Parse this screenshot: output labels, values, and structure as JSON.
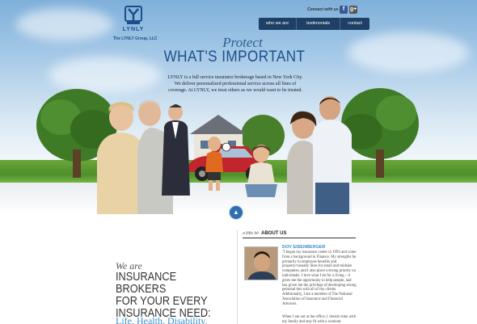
{
  "brand": {
    "logo_word": "LYNLY",
    "tagline": "The LYNLY Group, LLC"
  },
  "social": {
    "connect_label": "Connect with us on:",
    "icons": [
      "facebook-icon",
      "google-plus-icon"
    ]
  },
  "nav": {
    "items": [
      "who we are",
      "testimonials",
      "contact"
    ]
  },
  "hero": {
    "protect": "Protect",
    "headline": "WHAT'S IMPORTANT",
    "intro": "LYNLY is a full service insurance brokerage based in New York City. We deliver personalized professional service across all lines of coverage. At LYNLY, we treat others as we would want to be treated."
  },
  "insurance": {
    "we_are": "We are",
    "brokers_lines": [
      "INSURANCE BROKERS",
      "FOR YOUR EVERY",
      "INSURANCE NEED:"
    ],
    "tagline": "Life. Health. Disability."
  },
  "about": {
    "small_label": "a little bit",
    "big_label": "ABOUT US",
    "name": "DOV EISENBERGER",
    "bio": "\"I began my insurance career in 1993 and come from a background in Finance. My strengths lie primarily in employee benefits and property/casualty lines for small and midsize companies, and I also place a strong priority on individuals. I love what I do for a living – it gives me the opportunity to help people, and has given me the privilege of developing strong personal ties with all of my clients. Additionally, I am a member of The National Association of Insurance and Financial Advisors.",
    "bio2": "When I am not at the office, I cherish time with my family and stay fit with a workout"
  },
  "colors": {
    "nav_bg": "#1e3f66",
    "brand_blue": "#1c4f8a",
    "accent_blue": "#3b8fc9"
  }
}
